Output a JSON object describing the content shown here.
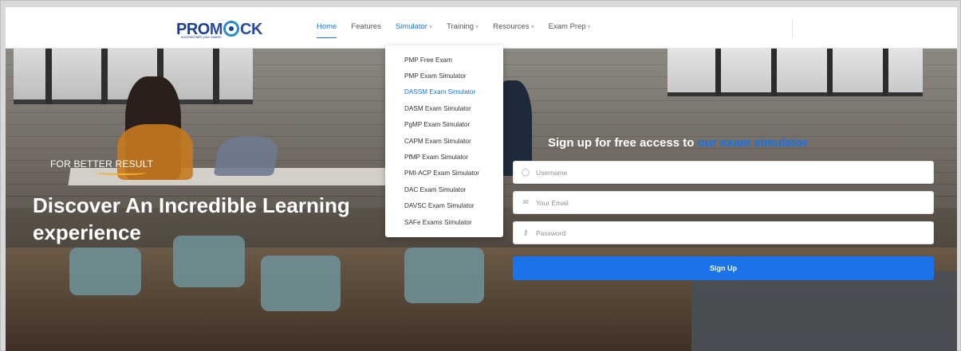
{
  "brand": {
    "logo_part1": "PRO",
    "logo_part2": "M",
    "logo_part3": "CK",
    "logo_tagline": "succeed with your          exams",
    "primary_color": "#1a73e8",
    "accent_color": "#f2b233"
  },
  "nav": {
    "items": [
      {
        "label": "Home",
        "active": true,
        "has_dropdown": false
      },
      {
        "label": "Features",
        "active": false,
        "has_dropdown": false
      },
      {
        "label": "Simulator",
        "active": false,
        "has_dropdown": true
      },
      {
        "label": "Training",
        "active": false,
        "has_dropdown": true
      },
      {
        "label": "Resources",
        "active": false,
        "has_dropdown": true
      },
      {
        "label": "Exam Prep",
        "active": false,
        "has_dropdown": true
      }
    ],
    "chevron": "˅"
  },
  "simulator_menu": {
    "items": [
      {
        "label": "PMP Free Exam",
        "highlighted": false
      },
      {
        "label": "PMP Exam Simulator",
        "highlighted": false
      },
      {
        "label": "DASSM Exam Simulator",
        "highlighted": true
      },
      {
        "label": "DASM Exam Simulator",
        "highlighted": false
      },
      {
        "label": "PgMP Exam Simulator",
        "highlighted": false
      },
      {
        "label": "CAPM Exam Simulator",
        "highlighted": false
      },
      {
        "label": "PfMP Exam Simulator",
        "highlighted": false
      },
      {
        "label": "PMI-ACP Exam Simulator",
        "highlighted": false
      },
      {
        "label": "DAC Exam Simulator",
        "highlighted": false
      },
      {
        "label": "DAVSC Exam Simulator",
        "highlighted": false
      },
      {
        "label": "SAFe Exams Simulator",
        "highlighted": false
      }
    ]
  },
  "hero": {
    "tagline": "FOR BETTER RESULT",
    "headline": "Discover An Incredible Learning experience"
  },
  "signup": {
    "title_prefix": "Sign up for free access to ",
    "title_accent": "our exam simulator",
    "username_placeholder": "Username",
    "email_placeholder": "Your Email",
    "password_placeholder": "Password",
    "button_label": "Sign Up",
    "icons": {
      "username": "user-icon",
      "email": "envelope-icon",
      "password": "key-icon"
    }
  }
}
